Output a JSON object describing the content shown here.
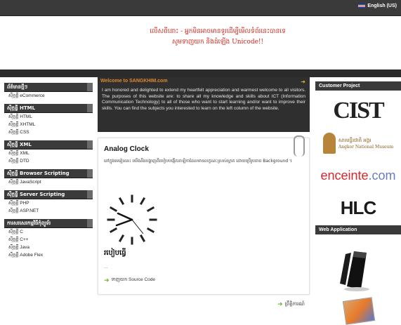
{
  "topbar": {
    "language": "English (US)"
  },
  "notice": {
    "line1": "លើសពីនោះ - អ្នកមិនអាចមានទូរដើម្បីមើលទំព័រនេះបានទេ",
    "line2": "សូមទាញយក និងដំឡើង Unicode!!"
  },
  "left": [
    {
      "heading": "ព័ត៌មានថ្មីៗ",
      "items": [
        "ស៊ីក្កខ្លី eCommerce"
      ]
    },
    {
      "heading": "ស៊ីក្កខ្លី HTML",
      "items": [
        "ស៊ីក្កខ្លី HTML",
        "ស៊ីក្កខ្លី XHTML",
        "ស៊ីក្កខ្លី CSS"
      ]
    },
    {
      "heading": "ស៊ីក្កខ្លី XML",
      "items": [
        "ស៊ីក្កខ្លី XML",
        "ស៊ីក្កខ្លី DTD"
      ]
    },
    {
      "heading": "ស៊ីក្កខ្លី Browser Scripting",
      "items": [
        "ស៊ីក្កខ្លី JavaScript"
      ]
    },
    {
      "heading": "ស៊ីក្កខ្លី Server Scripting",
      "items": [
        "ស៊ីក្កខ្លី PHP",
        "ស៊ីក្កខ្លី ASP.NET"
      ]
    },
    {
      "heading": "ការសរសេរកម្មវិធីកុំព្យូទ័រ",
      "items": [
        "ស៊ីក្កខ្លី C",
        "ស៊ីក្កខ្លី C++",
        "ស៊ីក្កខ្លី Java",
        "ស៊ីក្កខ្លី Adobe Flex"
      ]
    }
  ],
  "welcome": {
    "title": "Welcome to SANGKHIM.com",
    "body": "I am honored and delighted to extend my heartfelt appreciation and warmest welcome to all visitors. The purposes of this website are: to share all my knowledge and skills about ICT (Information Communication Technology) to all of those who want to start learning and/or want to improve their skills. You can find the subjects you interested to learn on the left column of the website."
  },
  "article": {
    "title": "Analog Clock",
    "desc": "នៅក្នុងមេរៀននេះ យើងនឹងបង្ហាញពីរបៀបបង្កើតនាឡិកាដែលមានលក្ខណៈស្រស់ស្អាត ដោយប្រើរូបភាព Background ។",
    "subtitle": "របៀបធ្វើ",
    "dots": "...",
    "source_link": "ទាញយក Source Code",
    "more_link": "ព្រឹត្តិការណ៍"
  },
  "right": {
    "customer_heading": "Customer Project",
    "logos": {
      "cist": "CIST",
      "angkor_title": "សារមន្ទីរជាតិ អង្គរ",
      "angkor_sub": "Angkor National Museum",
      "enceinte_a": "enceinte",
      "enceinte_b": ".com",
      "hlc": "HLC"
    },
    "web_heading": "Web Application"
  }
}
